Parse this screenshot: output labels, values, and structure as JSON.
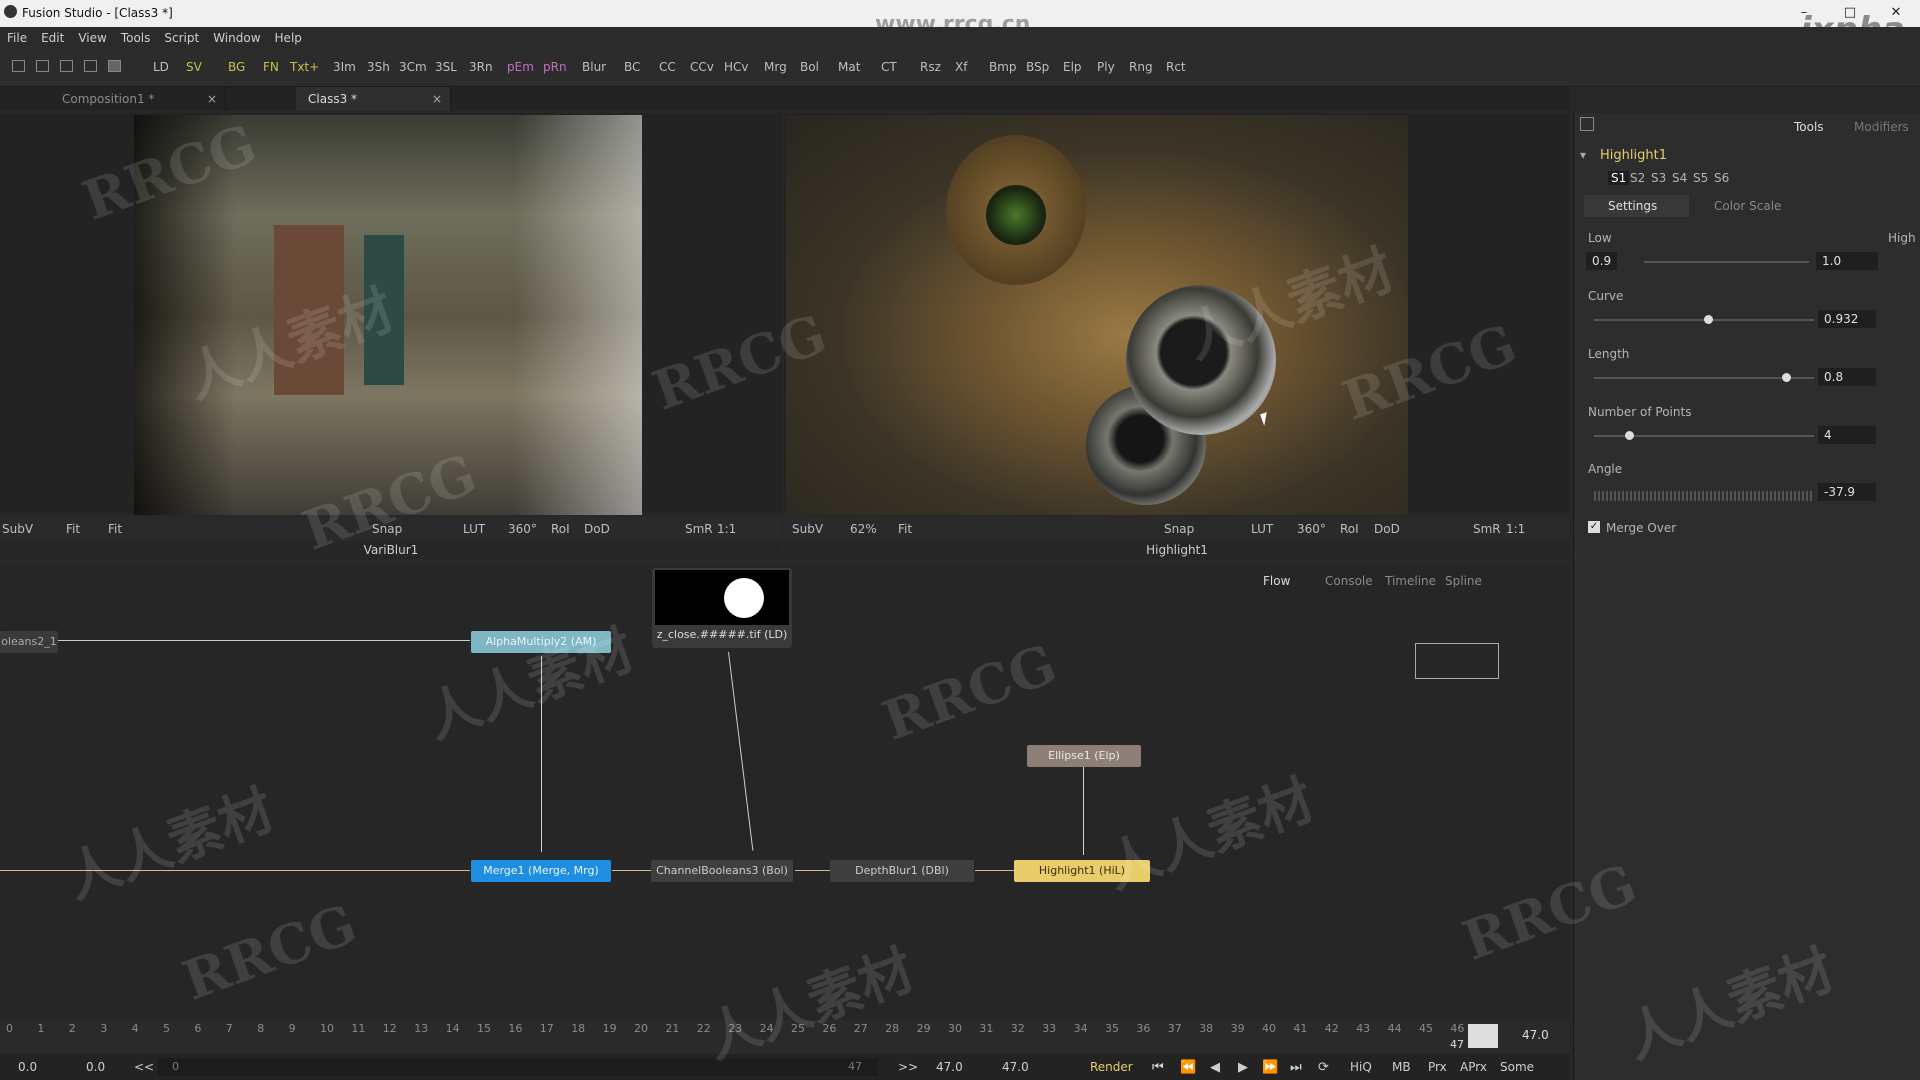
{
  "window": {
    "title": "Fusion Studio - [Class3 *]",
    "watermark_top": "www.rrcg.cn",
    "brand": "ixpha"
  },
  "menu": [
    "File",
    "Edit",
    "View",
    "Tools",
    "Script",
    "Window",
    "Help"
  ],
  "toolbar": {
    "items": [
      "LD",
      "SV",
      "BG",
      "FN",
      "Txt+",
      "3Im",
      "3Sh",
      "3Cm",
      "3SL",
      "3Rn",
      "pEm",
      "pRn",
      "Blur",
      "BC",
      "CC",
      "CCv",
      "HCv",
      "Mrg",
      "Bol",
      "Mat",
      "CT",
      "Rsz",
      "Xf",
      "Bmp",
      "BSp",
      "Elp",
      "Ply",
      "Rng",
      "Rct"
    ]
  },
  "tabs": [
    {
      "label": "Composition1 *"
    },
    {
      "label": "Class3 *"
    }
  ],
  "viewer_left": {
    "label": "VariBlur1",
    "toolbar": [
      "SubV",
      "Fit",
      "Fit",
      "Snap",
      "LUT",
      "360°",
      "RoI",
      "DoD",
      "SmR",
      "1:1"
    ]
  },
  "viewer_right": {
    "label": "Highlight1",
    "toolbar": [
      "SubV",
      "62%",
      "Fit",
      "Snap",
      "LUT",
      "360°",
      "RoI",
      "DoD",
      "SmR",
      "1:1"
    ]
  },
  "flow_tabs": [
    "Flow",
    "Console",
    "Timeline",
    "Spline"
  ],
  "nodes": {
    "booleans": "oleans2_1",
    "alpha": "AlphaMultiply2 (AM)",
    "loader": "z_close.#####.tif (LD)",
    "merge": "Merge1 (Merge, Mrg)",
    "channel": "ChannelBooleans3 (Bol)",
    "depth": "DepthBlur1 (DBl)",
    "highlight": "Highlight1 (HiL)",
    "ellipse": "Ellipse1 (Elp)"
  },
  "panel": {
    "tabs": [
      "Tools",
      "Modifiers"
    ],
    "tool_name": "Highlight1",
    "slots": [
      "S1",
      "S2",
      "S3",
      "S4",
      "S5",
      "S6"
    ],
    "subtabs": [
      "Settings",
      "Color Scale"
    ],
    "low_label": "Low",
    "high_label": "High",
    "low_value": "0.9",
    "high_value": "1.0",
    "curve_label": "Curve",
    "curve_value": "0.932",
    "length_label": "Length",
    "length_value": "0.8",
    "points_label": "Number of Points",
    "points_value": "4",
    "angle_label": "Angle",
    "angle_value": "-37.9",
    "merge_over_label": "Merge Over"
  },
  "timeline": {
    "ticks": [
      "0",
      "1",
      "2",
      "3",
      "4",
      "5",
      "6",
      "7",
      "8",
      "9",
      "10",
      "11",
      "12",
      "13",
      "14",
      "15",
      "16",
      "17",
      "18",
      "19",
      "20",
      "21",
      "22",
      "23",
      "24",
      "25",
      "26",
      "27",
      "28",
      "29",
      "30",
      "31",
      "32",
      "33",
      "34",
      "35",
      "36",
      "37",
      "38",
      "39",
      "40",
      "41",
      "42",
      "43",
      "44",
      "45",
      "46"
    ],
    "current": "47",
    "end_value": "47.0"
  },
  "bottom": {
    "start": "0.0",
    "render_start": "0.0",
    "back": "<<",
    "frame_field": "0",
    "frame_end": "47",
    "fwd": ">>",
    "render_end": "47.0",
    "global_end": "47.0",
    "render": "Render",
    "hiq": "HiQ",
    "mb": "MB",
    "prx": "Prx",
    "aprx": "APrx",
    "some": "Some"
  },
  "watermarks": [
    "RRCG",
    "人人素材"
  ]
}
